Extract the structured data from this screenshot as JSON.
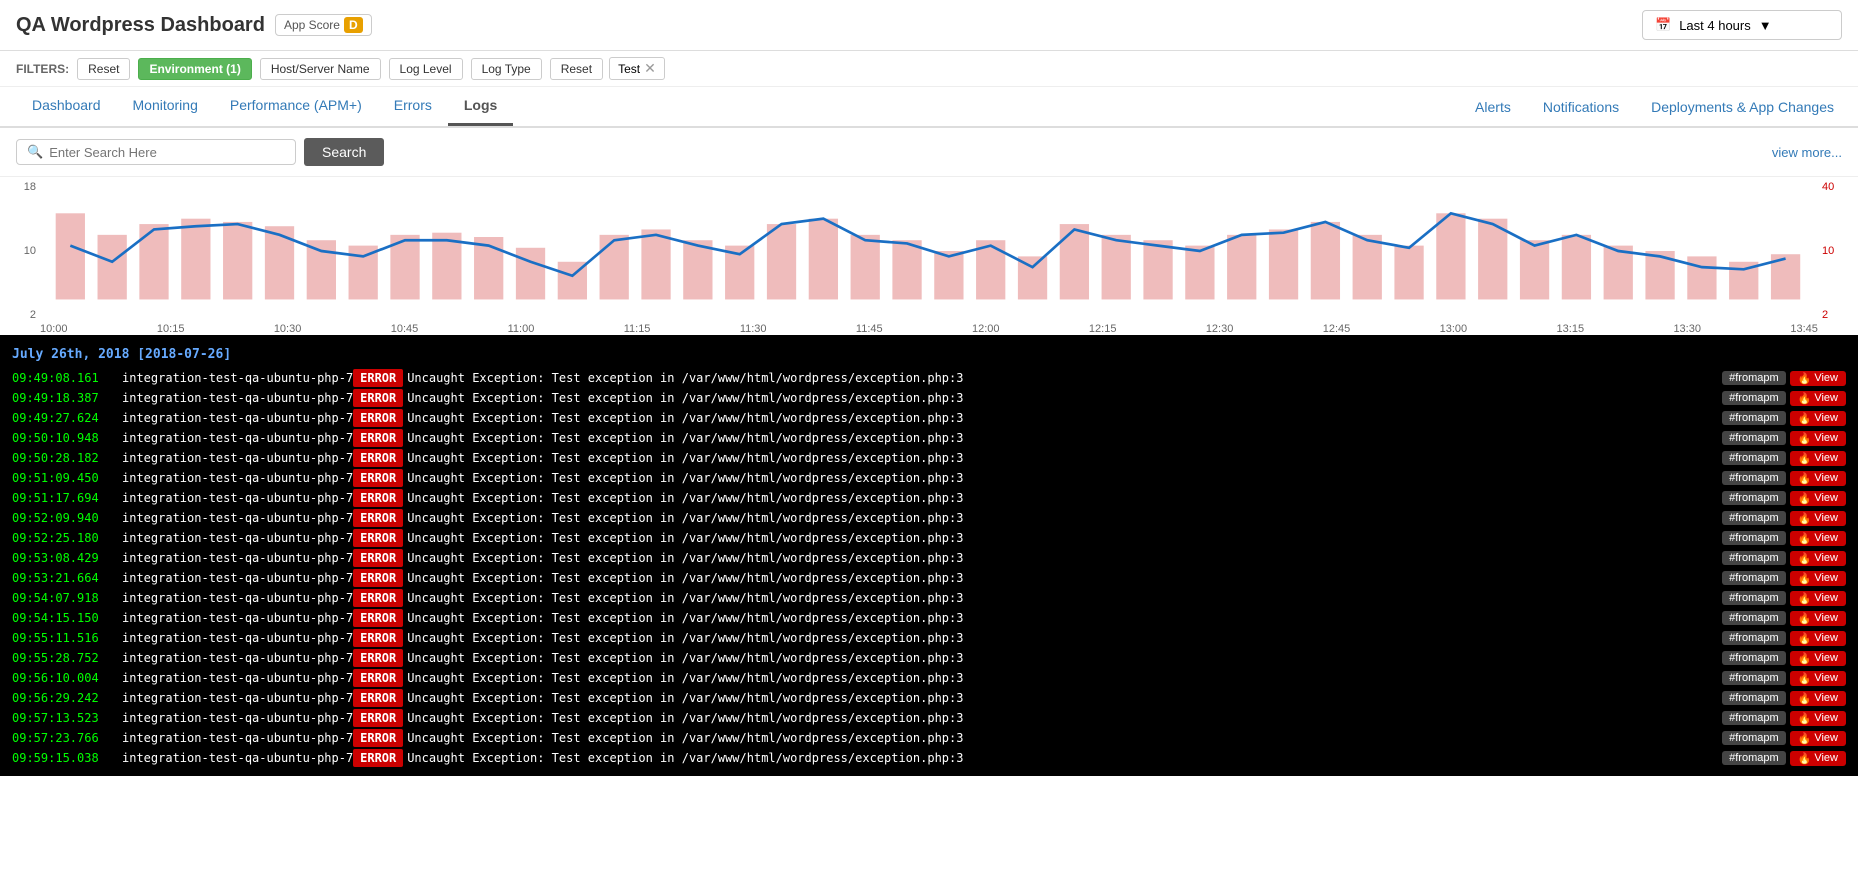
{
  "header": {
    "title": "QA Wordpress Dashboard",
    "app_score_label": "App Score",
    "score_letter": "D",
    "time_selector_label": "Last 4 hours",
    "calendar_icon": "📅"
  },
  "filters": {
    "label": "FILTERS:",
    "reset_label": "Reset",
    "env_label": "Environment (1)",
    "host_label": "Host/Server Name",
    "log_level_label": "Log Level",
    "log_type_label": "Log Type",
    "tag_reset": "Reset",
    "tag_name": "Test",
    "tag_close": "✕"
  },
  "nav": {
    "tabs": [
      {
        "id": "dashboard",
        "label": "Dashboard"
      },
      {
        "id": "monitoring",
        "label": "Monitoring"
      },
      {
        "id": "performance",
        "label": "Performance (APM+)"
      },
      {
        "id": "errors",
        "label": "Errors"
      },
      {
        "id": "logs",
        "label": "Logs",
        "active": true
      }
    ],
    "right_tabs": [
      {
        "id": "alerts",
        "label": "Alerts"
      },
      {
        "id": "notifications",
        "label": "Notifications"
      },
      {
        "id": "deployments",
        "label": "Deployments & App Changes"
      }
    ]
  },
  "search": {
    "placeholder": "Enter Search Here",
    "button_label": "Search",
    "view_more_label": "view more..."
  },
  "chart": {
    "y_left_labels": [
      "18",
      "10",
      "2"
    ],
    "y_right_labels": [
      "40",
      "10",
      "2"
    ],
    "x_labels": [
      "10:00",
      "10:15",
      "10:30",
      "10:45",
      "11:00",
      "11:15",
      "11:30",
      "11:45",
      "12:00",
      "12:15",
      "12:30",
      "12:45",
      "13:00",
      "13:15",
      "13:30",
      "13:45"
    ]
  },
  "log_section": {
    "date_header": "July 26th, 2018 [2018-07-26]",
    "rows": [
      {
        "time": "09:49:08.161",
        "server": "integration-test-qa-ubuntu-php-7",
        "level": "ERROR",
        "message": "Uncaught Exception: Test exception in /var/www/html/wordpress/exception.php:3"
      },
      {
        "time": "09:49:18.387",
        "server": "integration-test-qa-ubuntu-php-7",
        "level": "ERROR",
        "message": "Uncaught Exception: Test exception in /var/www/html/wordpress/exception.php:3"
      },
      {
        "time": "09:49:27.624",
        "server": "integration-test-qa-ubuntu-php-7",
        "level": "ERROR",
        "message": "Uncaught Exception: Test exception in /var/www/html/wordpress/exception.php:3"
      },
      {
        "time": "09:50:10.948",
        "server": "integration-test-qa-ubuntu-php-7",
        "level": "ERROR",
        "message": "Uncaught Exception: Test exception in /var/www/html/wordpress/exception.php:3"
      },
      {
        "time": "09:50:28.182",
        "server": "integration-test-qa-ubuntu-php-7",
        "level": "ERROR",
        "message": "Uncaught Exception: Test exception in /var/www/html/wordpress/exception.php:3"
      },
      {
        "time": "09:51:09.450",
        "server": "integration-test-qa-ubuntu-php-7",
        "level": "ERROR",
        "message": "Uncaught Exception: Test exception in /var/www/html/wordpress/exception.php:3"
      },
      {
        "time": "09:51:17.694",
        "server": "integration-test-qa-ubuntu-php-7",
        "level": "ERROR",
        "message": "Uncaught Exception: Test exception in /var/www/html/wordpress/exception.php:3"
      },
      {
        "time": "09:52:09.940",
        "server": "integration-test-qa-ubuntu-php-7",
        "level": "ERROR",
        "message": "Uncaught Exception: Test exception in /var/www/html/wordpress/exception.php:3"
      },
      {
        "time": "09:52:25.180",
        "server": "integration-test-qa-ubuntu-php-7",
        "level": "ERROR",
        "message": "Uncaught Exception: Test exception in /var/www/html/wordpress/exception.php:3"
      },
      {
        "time": "09:53:08.429",
        "server": "integration-test-qa-ubuntu-php-7",
        "level": "ERROR",
        "message": "Uncaught Exception: Test exception in /var/www/html/wordpress/exception.php:3"
      },
      {
        "time": "09:53:21.664",
        "server": "integration-test-qa-ubuntu-php-7",
        "level": "ERROR",
        "message": "Uncaught Exception: Test exception in /var/www/html/wordpress/exception.php:3"
      },
      {
        "time": "09:54:07.918",
        "server": "integration-test-qa-ubuntu-php-7",
        "level": "ERROR",
        "message": "Uncaught Exception: Test exception in /var/www/html/wordpress/exception.php:3"
      },
      {
        "time": "09:54:15.150",
        "server": "integration-test-qa-ubuntu-php-7",
        "level": "ERROR",
        "message": "Uncaught Exception: Test exception in /var/www/html/wordpress/exception.php:3"
      },
      {
        "time": "09:55:11.516",
        "server": "integration-test-qa-ubuntu-php-7",
        "level": "ERROR",
        "message": "Uncaught Exception: Test exception in /var/www/html/wordpress/exception.php:3"
      },
      {
        "time": "09:55:28.752",
        "server": "integration-test-qa-ubuntu-php-7",
        "level": "ERROR",
        "message": "Uncaught Exception: Test exception in /var/www/html/wordpress/exception.php:3"
      },
      {
        "time": "09:56:10.004",
        "server": "integration-test-qa-ubuntu-php-7",
        "level": "ERROR",
        "message": "Uncaught Exception: Test exception in /var/www/html/wordpress/exception.php:3"
      },
      {
        "time": "09:56:29.242",
        "server": "integration-test-qa-ubuntu-php-7",
        "level": "ERROR",
        "message": "Uncaught Exception: Test exception in /var/www/html/wordpress/exception.php:3"
      },
      {
        "time": "09:57:13.523",
        "server": "integration-test-qa-ubuntu-php-7",
        "level": "ERROR",
        "message": "Uncaught Exception: Test exception in /var/www/html/wordpress/exception.php:3"
      },
      {
        "time": "09:57:23.766",
        "server": "integration-test-qa-ubuntu-php-7",
        "level": "ERROR",
        "message": "Uncaught Exception: Test exception in /var/www/html/wordpress/exception.php:3"
      },
      {
        "time": "09:59:15.038",
        "server": "integration-test-qa-ubuntu-php-7",
        "level": "ERROR",
        "message": "Uncaught Exception: Test exception in /var/www/html/wordpress/exception.php:3"
      }
    ],
    "fromapm_label": "#fromapm",
    "view_label": "View",
    "view_icon": "🔥"
  }
}
